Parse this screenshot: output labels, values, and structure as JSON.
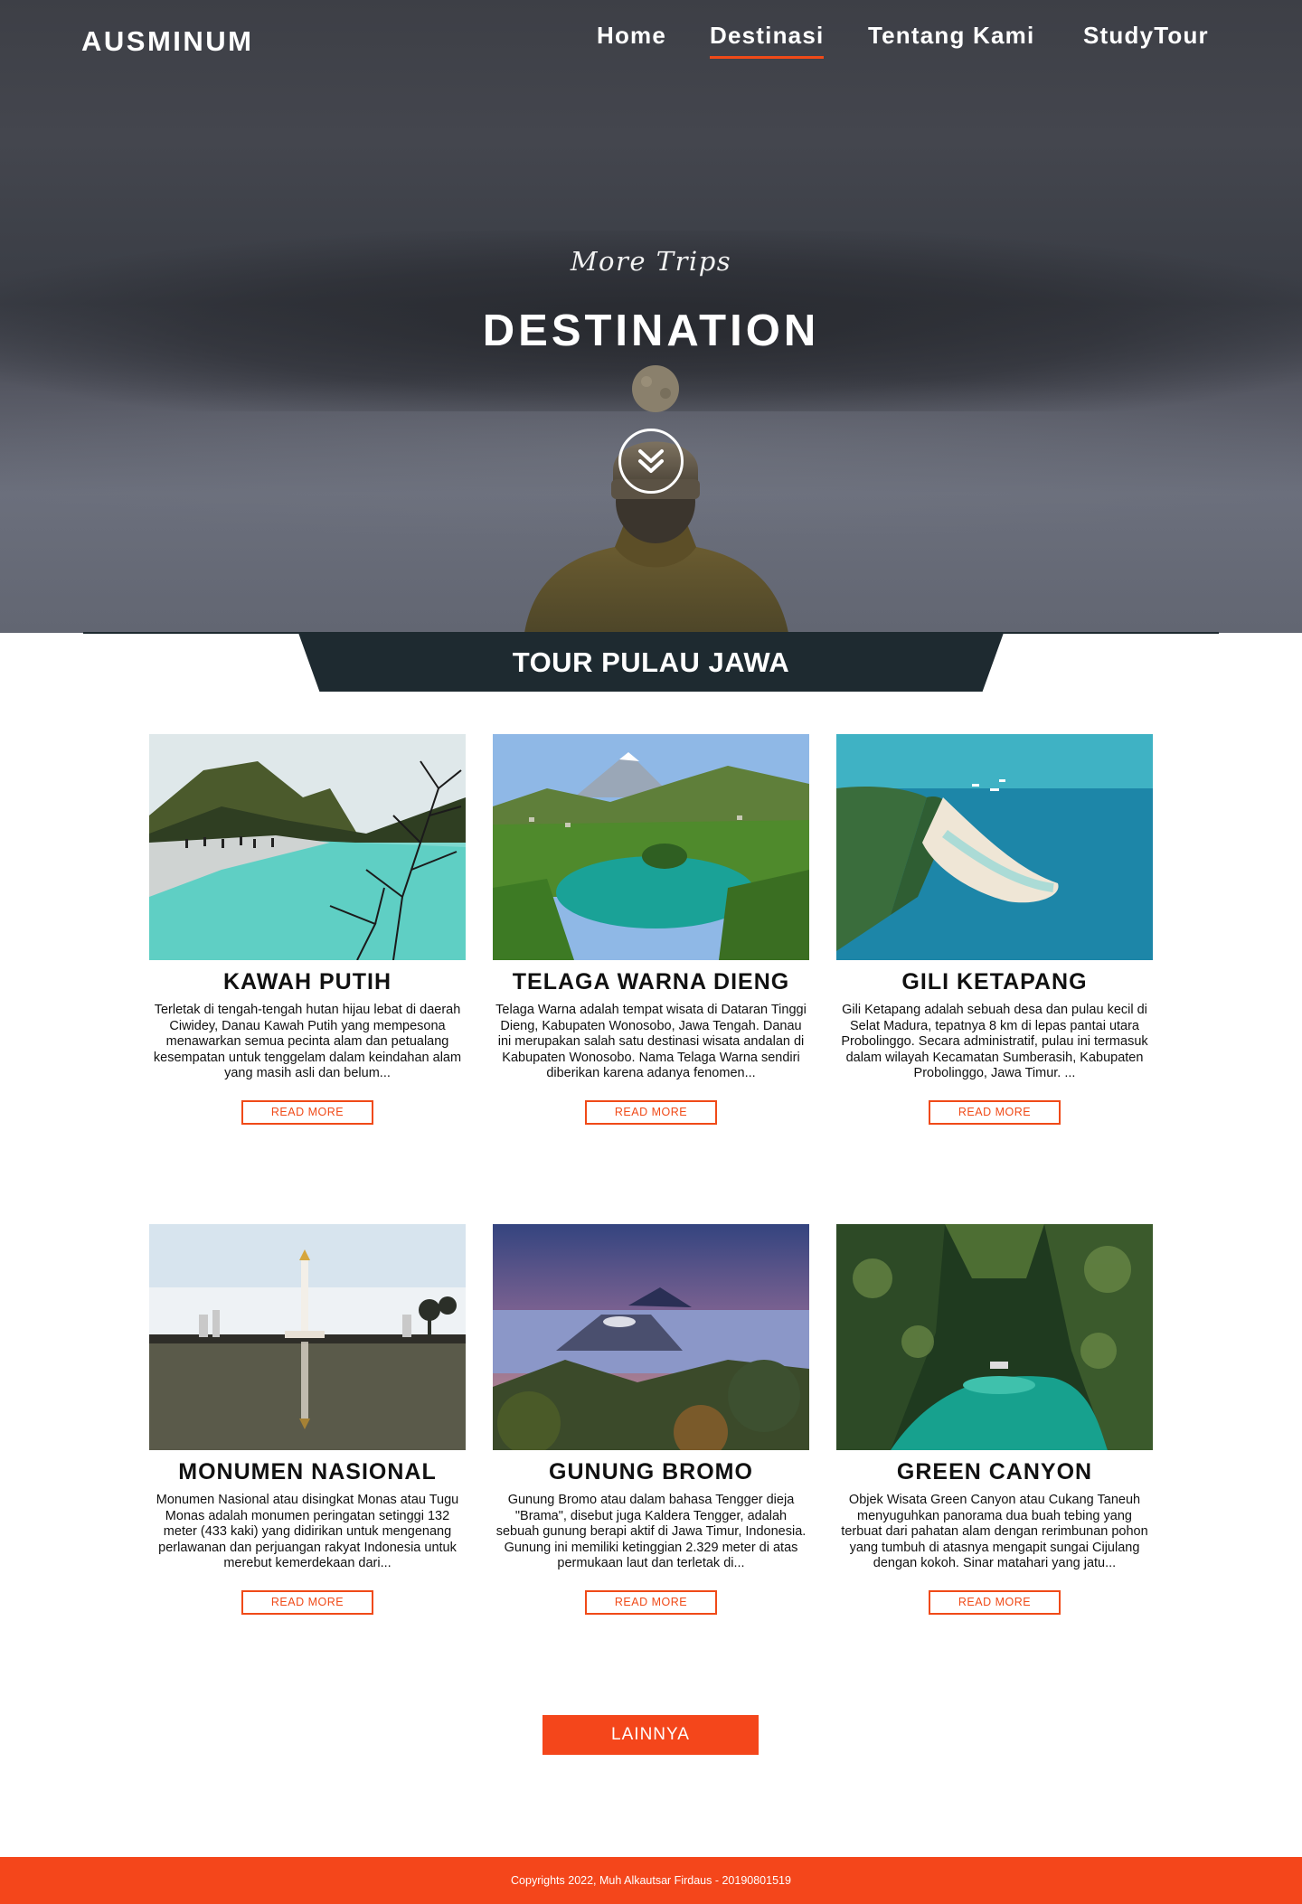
{
  "brand": {
    "logo": "AUSMINUM",
    "accent": "#f04a18",
    "dark": "#1e2a30"
  },
  "nav": {
    "items": [
      {
        "label": "Home",
        "active": false
      },
      {
        "label": "Destinasi",
        "active": true
      },
      {
        "label": "Tentang Kami",
        "active": false
      },
      {
        "label": "StudyTour",
        "active": false
      }
    ]
  },
  "hero": {
    "subtitle": "More Trips",
    "title": "DESTINATION",
    "scroll_icon": "chevron-double-down-icon"
  },
  "section": {
    "title": "TOUR PULAU JAWA"
  },
  "cards": [
    {
      "title": "KAWAH PUTIH",
      "description": "Terletak di tengah-tengah hutan hijau lebat di daerah Ciwidey, Danau Kawah Putih yang mempesona menawarkan semua pecinta alam dan petualang kesempatan untuk tenggelam dalam keindahan alam yang masih asli dan belum...",
      "button": "READ MORE"
    },
    {
      "title": "TELAGA WARNA DIENG",
      "description": "Telaga Warna adalah tempat wisata di Dataran Tinggi Dieng, Kabupaten Wonosobo, Jawa Tengah. Danau ini merupakan salah satu destinasi wisata andalan di Kabupaten Wonosobo. Nama Telaga Warna sendiri diberikan karena adanya fenomen...",
      "button": "READ MORE"
    },
    {
      "title": "GILI KETAPANG",
      "description": "Gili Ketapang adalah sebuah desa dan pulau kecil di Selat Madura, tepatnya 8 km di lepas pantai utara Probolinggo. Secara administratif, pulau ini termasuk dalam wilayah Kecamatan Sumberasih, Kabupaten Probolinggo, Jawa Timur. ...",
      "button": "READ MORE"
    },
    {
      "title": "MONUMEN NASIONAL",
      "description": "Monumen Nasional atau disingkat Monas atau Tugu Monas adalah monumen peringatan setinggi 132 meter (433 kaki) yang didirikan untuk mengenang perlawanan dan perjuangan rakyat Indonesia untuk merebut kemerdekaan dari...",
      "button": "READ MORE"
    },
    {
      "title": "GUNUNG BROMO",
      "description": "Gunung Bromo atau dalam bahasa Tengger dieja \"Brama\", disebut juga Kaldera Tengger, adalah sebuah gunung berapi aktif di Jawa Timur, Indonesia. Gunung ini memiliki ketinggian 2.329 meter di atas permukaan laut dan terletak di...",
      "button": "READ MORE"
    },
    {
      "title": "GREEN CANYON",
      "description": "Objek Wisata Green Canyon atau Cukang Taneuh menyuguhkan panorama dua buah tebing yang terbuat dari pahatan alam dengan rerimbunan pohon yang tumbuh di atasnya mengapit sungai Cijulang dengan kokoh. Sinar matahari yang jatu...",
      "button": "READ MORE"
    }
  ],
  "more_button": "LAINNYA",
  "footer": {
    "text": "Copyrights 2022, Muh Alkautsar Firdaus - 20190801519"
  }
}
